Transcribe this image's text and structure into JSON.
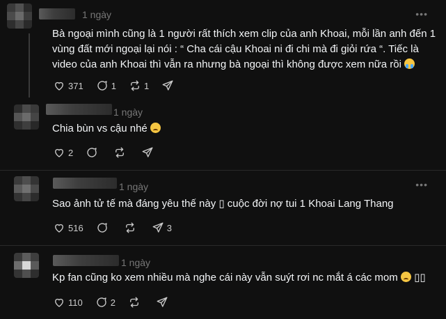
{
  "posts": [
    {
      "time": "1 ngày",
      "text": "Bà ngoại mình cũng là 1 người rất thích xem clip của anh Khoai, mỗi lần anh đến 1 vùng đất mới ngoại lại nói : “ Cha cái cậu Khoai ni đi chi mà đi giỏi rứa “. Tiếc là video của anh Khoai thì vẫn ra nhưng bà ngoại thì không được xem nữa rồi",
      "emoji": "crying-face",
      "likes": "371",
      "replies": "1",
      "reposts": "1",
      "shares": ""
    },
    {
      "time": "1 ngày",
      "text": "Chia bùn vs cậu nhé",
      "emoji": "sad-face",
      "likes": "2",
      "replies": "",
      "reposts": "",
      "shares": ""
    },
    {
      "time": "1 ngày",
      "text": "Sao ảnh tử tế mà đáng yêu thế này ▯ cuộc đời nợ tui 1 Khoai Lang Thang",
      "emoji": "",
      "likes": "516",
      "replies": "",
      "reposts": "",
      "shares": "3"
    },
    {
      "time": "1 ngày",
      "text": "Kp fan cũng ko xem nhiều mà nghe cái này vẫn suýt rơi nc mắt á các mom",
      "emoji": "sad-face",
      "emoji_suffix": "▯▯",
      "likes": "110",
      "replies": "2",
      "reposts": "",
      "shares": ""
    }
  ],
  "more_label": "•••",
  "colors": {
    "background": "#101010",
    "text": "#f3f5f7",
    "muted": "#777777",
    "divider": "#2a2a2a"
  }
}
